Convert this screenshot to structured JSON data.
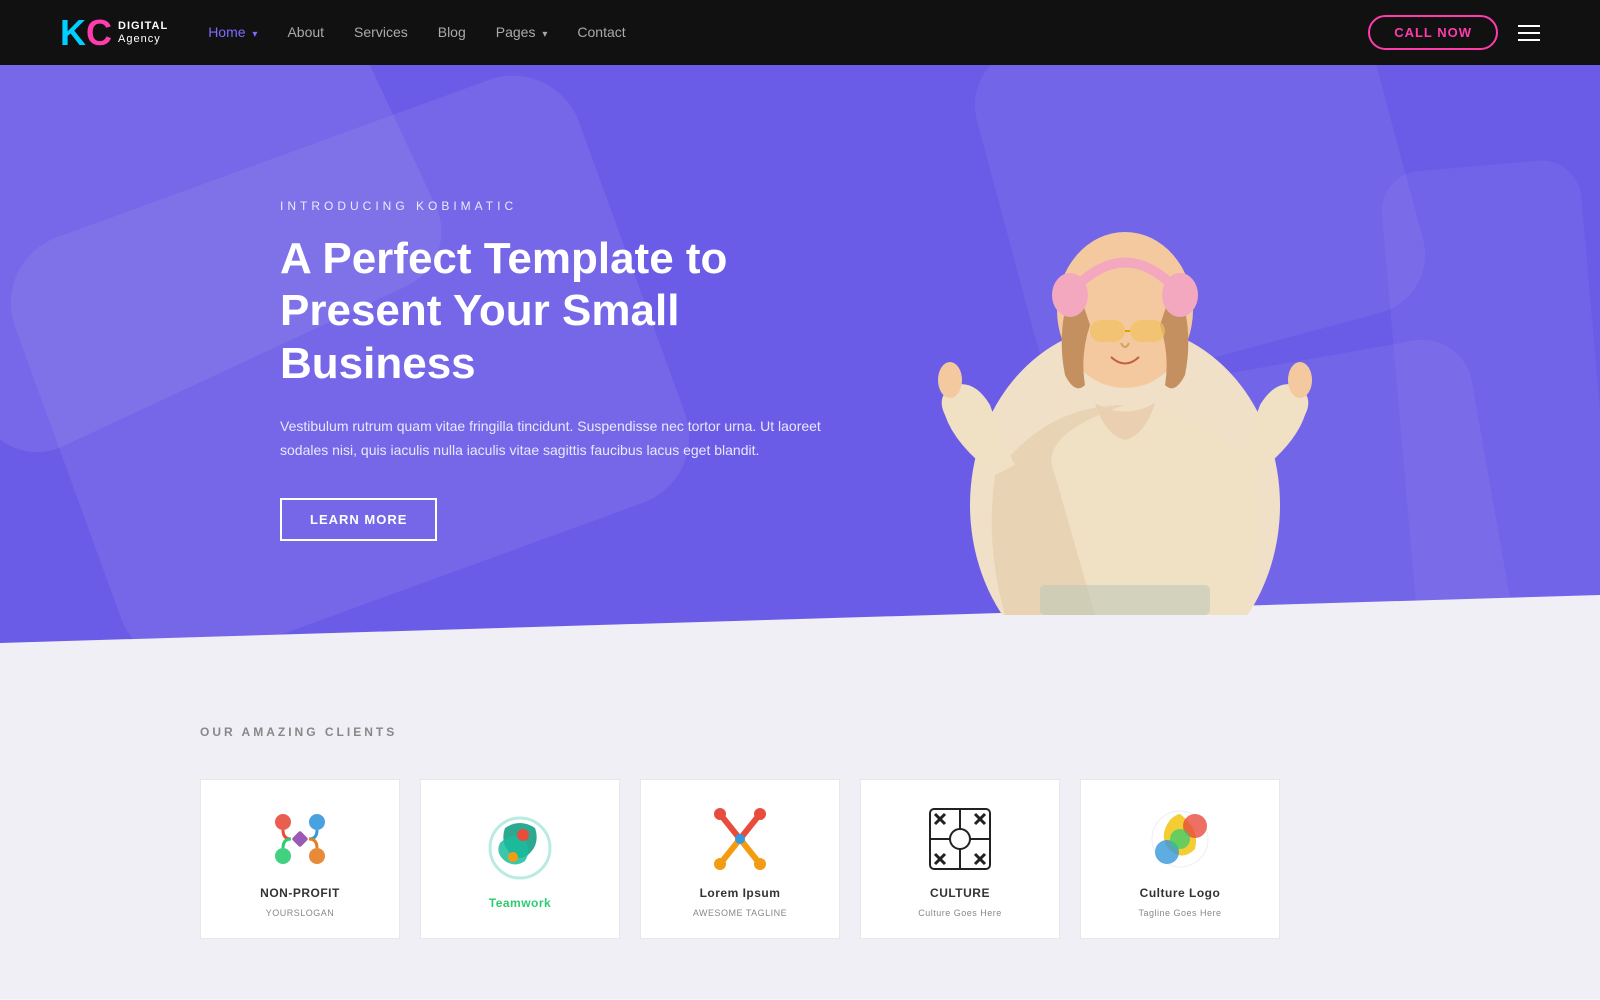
{
  "navbar": {
    "logo": {
      "k": "K",
      "c": "C",
      "digital": "DIGITAL",
      "agency": "Agency"
    },
    "nav_items": [
      {
        "label": "Home",
        "active": true,
        "has_arrow": true
      },
      {
        "label": "About",
        "active": false,
        "has_arrow": false
      },
      {
        "label": "Services",
        "active": false,
        "has_arrow": false
      },
      {
        "label": "Blog",
        "active": false,
        "has_arrow": false
      },
      {
        "label": "Pages",
        "active": false,
        "has_arrow": true
      },
      {
        "label": "Contact",
        "active": false,
        "has_arrow": false
      }
    ],
    "cta_button": "CALL NOW",
    "hamburger_label": "menu"
  },
  "hero": {
    "intro": "INTRODUCING KOBIMATIC",
    "title": "A Perfect Template to Present Your Small Business",
    "description": "Vestibulum rutrum quam vitae fringilla tincidunt. Suspendisse nec tortor urna. Ut laoreet sodales nisi, quis iaculis nulla iaculis vitae sagittis faucibus lacus eget blandit.",
    "cta_button": "LEARN MORE"
  },
  "clients": {
    "section_label": "OUR AMAZING CLIENTS",
    "items": [
      {
        "name": "NON-PROFIT",
        "sub": "YOURSLOGAN",
        "logo_type": "nonprofit"
      },
      {
        "name": "Teamwork",
        "sub": "",
        "logo_type": "teamwork"
      },
      {
        "name": "Lorem Ipsum",
        "sub": "AWESOME TAGLINE",
        "logo_type": "lorem"
      },
      {
        "name": "CULTURE",
        "sub": "Culture Goes Here",
        "logo_type": "culture"
      },
      {
        "name": "Culture Logo",
        "sub": "Tagline Goes Here",
        "logo_type": "culturelogo"
      }
    ]
  }
}
